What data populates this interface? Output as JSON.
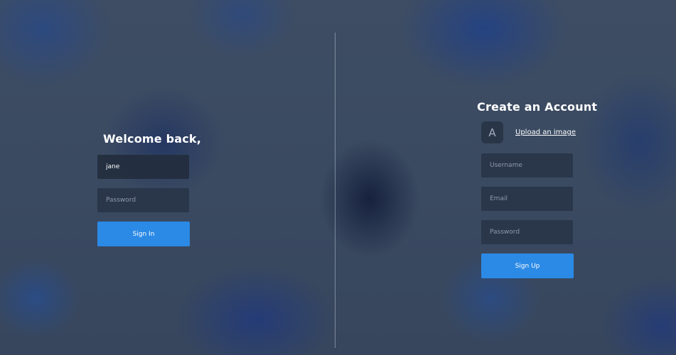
{
  "login": {
    "title": "Welcome back,",
    "username_value": "jane",
    "password_placeholder": "Password",
    "signin_label": "Sign In"
  },
  "signup": {
    "title": "Create an Account",
    "avatar_letter": "A",
    "upload_label": "Upload an image",
    "username_placeholder": "Username",
    "email_placeholder": "Email",
    "password_placeholder": "Password",
    "signup_label": "Sign Up"
  },
  "colors": {
    "accent": "#2b8ae6",
    "background": "#3b4a60",
    "field_bg": "#28344a"
  }
}
